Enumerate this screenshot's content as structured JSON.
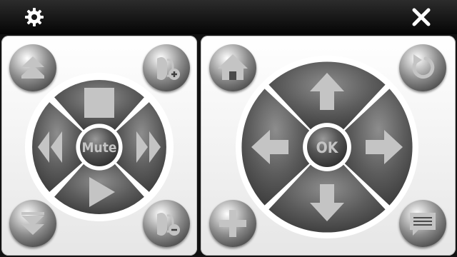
{
  "topbar": {
    "settings_icon": "gear-icon",
    "close_icon": "close-icon"
  },
  "left_pad": {
    "center_label": "Mute",
    "corner_buttons": [
      {
        "icon": "page-up-icon"
      },
      {
        "icon": "volume-up-icon"
      },
      {
        "icon": "page-down-icon"
      },
      {
        "icon": "volume-down-icon"
      }
    ],
    "segments": [
      {
        "icon": "stop-icon"
      },
      {
        "icon": "rewind-icon"
      },
      {
        "icon": "fast-forward-icon"
      },
      {
        "icon": "play-icon"
      }
    ]
  },
  "right_pad": {
    "center_label": "OK",
    "corner_buttons": [
      {
        "icon": "home-icon"
      },
      {
        "icon": "back-icon"
      },
      {
        "icon": "plus-icon"
      },
      {
        "icon": "message-icon"
      }
    ],
    "segments": [
      {
        "icon": "arrow-up-icon"
      },
      {
        "icon": "arrow-left-icon"
      },
      {
        "icon": "arrow-right-icon"
      },
      {
        "icon": "arrow-down-icon"
      }
    ]
  },
  "colors": {
    "button_dark": "#4f4f4f",
    "icon_light": "#c4c4c4",
    "panel_bg": "#f2f2f2",
    "bar_bg": "#0a0a0a"
  }
}
